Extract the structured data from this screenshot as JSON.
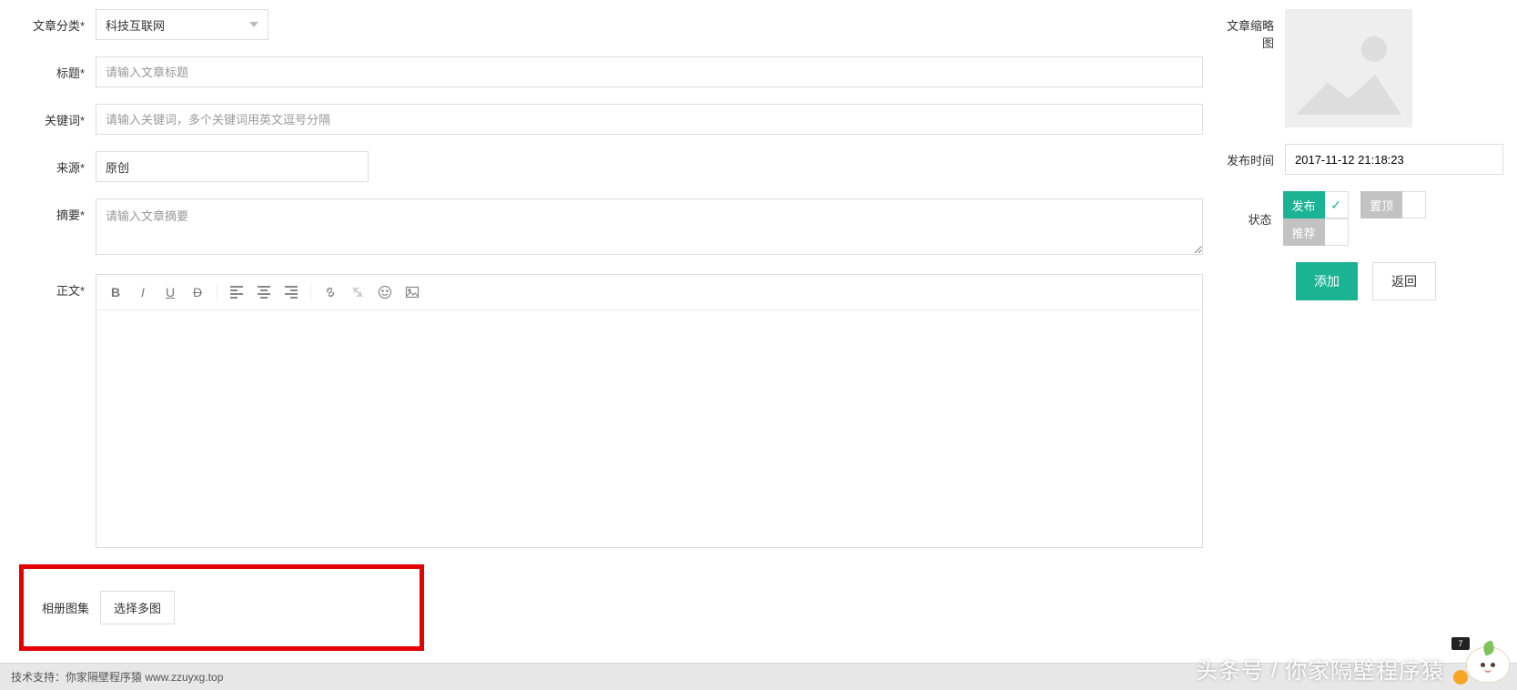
{
  "form": {
    "category": {
      "label": "文章分类*",
      "value": "科技互联网"
    },
    "title": {
      "label": "标题*",
      "placeholder": "请输入文章标题"
    },
    "keywords": {
      "label": "关键词*",
      "placeholder": "请输入关键词，多个关键词用英文逗号分隔"
    },
    "source": {
      "label": "来源*",
      "value": "原创"
    },
    "summary": {
      "label": "摘要*",
      "placeholder": "请输入文章摘要"
    },
    "content": {
      "label": "正文*"
    },
    "gallery": {
      "label": "相册图集",
      "button": "选择多图"
    }
  },
  "side": {
    "thumbnail": {
      "label": "文章缩略图"
    },
    "publish_time": {
      "label": "发布时间",
      "value": "2017-11-12 21:18:23"
    },
    "status": {
      "label": "状态",
      "publish": "发布",
      "sticky": "置顶",
      "recommend": "推荐"
    },
    "actions": {
      "add": "添加",
      "back": "返回"
    }
  },
  "footer": "技术支持：你家隔壁程序猿 www.zzuyxg.top",
  "watermark": "头条号 / 你家隔壁程序猿",
  "mascot_badge": "7"
}
